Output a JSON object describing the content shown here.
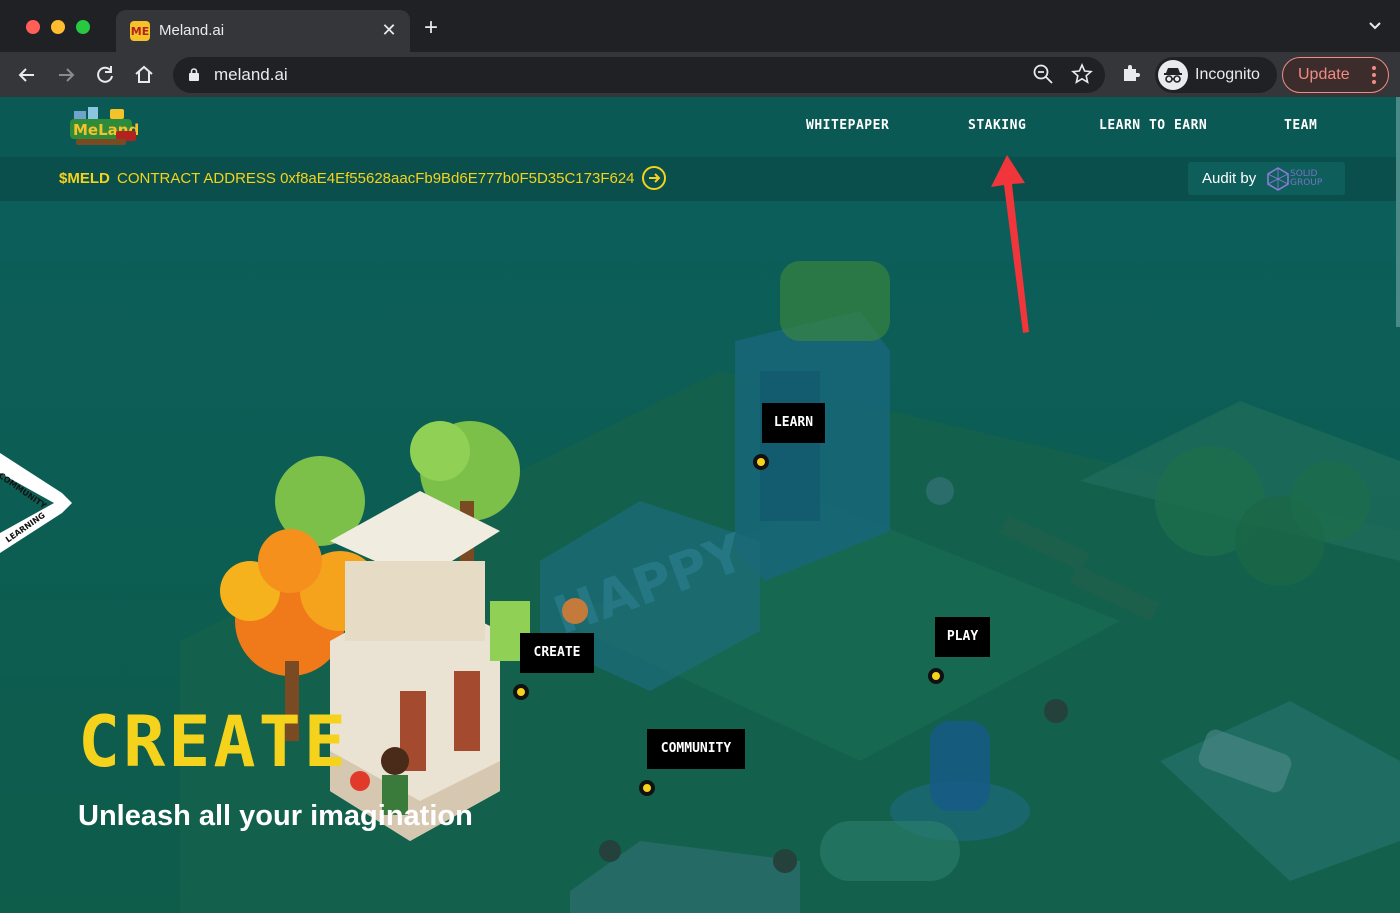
{
  "browser": {
    "tab": {
      "favicon_text": "ME",
      "title": "Meland.ai",
      "close": "✕"
    },
    "new_tab": "+",
    "url": "meland.ai",
    "profile_label": "Incognito",
    "update_label": "Update",
    "colors": {
      "frame": "#202124",
      "toolbar": "#35363a",
      "update_accent": "#f28b82"
    }
  },
  "site": {
    "logo_alt": "Meland.ai",
    "nav": [
      {
        "label": "WHITEPAPER"
      },
      {
        "label": "STAKING"
      },
      {
        "label": "LEARN TO EARN"
      },
      {
        "label": "TEAM"
      }
    ],
    "contract": {
      "token": "$MELD",
      "label": "CONTRACT ADDRESS 0xf8aE4Ef55628aacFb9Bd6E777b0F5D35C173F624"
    },
    "audit": {
      "label": "Audit by",
      "brand_line1": "SOLID",
      "brand_line2": "GROUP"
    },
    "side_tabs": {
      "top": "COMMUNITY",
      "bottom": "LEARNING"
    },
    "map_labels": {
      "learn": "LEARN",
      "create": "CREATE",
      "play": "PLAY",
      "community": "COMMUNITY"
    },
    "hero": {
      "title": "CREATE",
      "subtitle": "Unleash all your imagination"
    },
    "colors": {
      "accent": "#f5d31c",
      "background": "#0b5d59",
      "annotation_arrow": "#f0353b"
    }
  }
}
